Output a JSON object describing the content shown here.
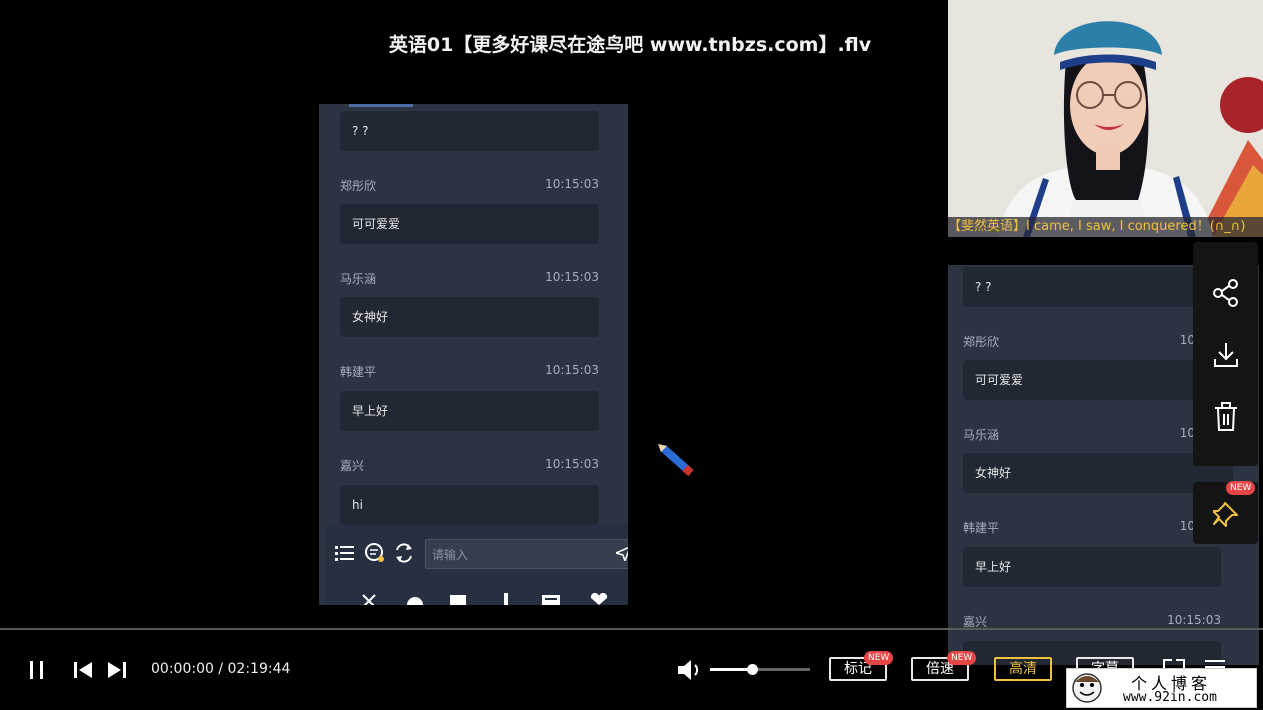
{
  "window": {
    "title": "英语01【更多好课尽在途鸟吧 www.tnbzs.com】.flv"
  },
  "chat_main": {
    "first_bubble": "? ?",
    "messages": [
      {
        "user": "郑彤欣",
        "time": "10:15:03",
        "text": "可可爱爱"
      },
      {
        "user": "马乐涵",
        "time": "10:15:03",
        "text": "女神好"
      },
      {
        "user": "韩建平",
        "time": "10:15:03",
        "text": "早上好"
      },
      {
        "user": "嘉兴",
        "time": "10:15:03",
        "text": "hi"
      }
    ],
    "input_placeholder": "请输入"
  },
  "webcam": {
    "caption": "【斐然英语】I came, I saw, I conquered！(∩_∩)"
  },
  "chat_side": {
    "first_bubble": "? ?",
    "messages": [
      {
        "user": "郑彤欣",
        "time": "10:",
        "text": "可可爱爱"
      },
      {
        "user": "马乐涵",
        "time": "10:",
        "text": "女神好"
      },
      {
        "user": "韩建平",
        "time": "10:",
        "text": "早上好"
      },
      {
        "user": "嘉兴",
        "time": "10:15:03",
        "text": ""
      }
    ]
  },
  "side_toolbar": {
    "icons": [
      "share-icon",
      "download-icon",
      "trash-icon",
      "pin-icon"
    ],
    "pin_badge": "NEW"
  },
  "player": {
    "time_current": "00:00:00",
    "time_separator": " / ",
    "time_total": "02:19:44",
    "volume_fraction": 0.42,
    "buttons": {
      "mark": "标记",
      "mark_badge": "NEW",
      "speed": "倍速",
      "speed_badge": "NEW",
      "quality": "高清",
      "subtitle": "字幕"
    },
    "accent_color": "#f0c040"
  },
  "watermark": {
    "name": "个人博客",
    "url": "www.92in.com"
  }
}
